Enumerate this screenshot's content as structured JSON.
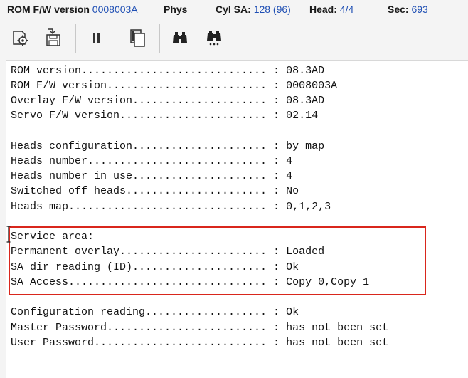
{
  "status": {
    "rom_fw_label": "ROM F/W version",
    "rom_fw_value": "0008003A",
    "mode": "Phys",
    "cyl_sa_label": "Cyl SA:",
    "cyl_sa_value": "128 (96)",
    "head_label": "Head:",
    "head_value": "4/4",
    "sec_label": "Sec:",
    "sec_value": "693"
  },
  "toolbar": {
    "buttons": [
      {
        "icon": "gear-chip-icon"
      },
      {
        "icon": "save-disk-icon"
      },
      {
        "icon": "pause-icon"
      },
      {
        "icon": "copy-pages-icon"
      },
      {
        "icon": "binoculars-icon"
      },
      {
        "icon": "binoculars-dots-icon"
      }
    ]
  },
  "console": {
    "lines": [
      "ROM version............................. : 08.3AD",
      "ROM F/W version......................... : 0008003A",
      "Overlay F/W version..................... : 08.3AD",
      "Servo F/W version....................... : 02.14",
      "",
      "Heads configuration..................... : by map",
      "Heads number............................ : 4",
      "Heads number in use..................... : 4",
      "Switched off heads...................... : No",
      "Heads map............................... : 0,1,2,3",
      "",
      "Service area:",
      "Permanent overlay....................... : Loaded",
      "SA dir reading (ID)..................... : Ok",
      "SA Access............................... : Copy 0,Copy 1",
      "",
      "Configuration reading................... : Ok",
      "Master Password......................... : has not been set",
      "User Password........................... : has not been set"
    ],
    "highlight_color": "#d9261c"
  }
}
